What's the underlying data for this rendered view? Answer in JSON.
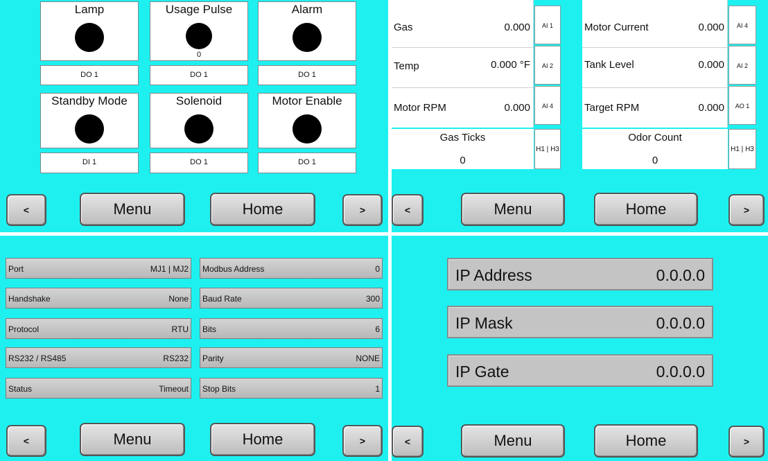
{
  "nav": {
    "prev": "<",
    "menu": "Menu",
    "home": "Home",
    "next": ">"
  },
  "panel1": {
    "indicators": [
      {
        "title": "Lamp",
        "value": "",
        "channel": "DO 1"
      },
      {
        "title": "Usage Pulse",
        "value": "0",
        "channel": "DO 1"
      },
      {
        "title": "Alarm",
        "value": "",
        "channel": "DO 1"
      },
      {
        "title": "Standby Mode",
        "value": "",
        "channel": "DI 1"
      },
      {
        "title": "Solenoid",
        "value": "",
        "channel": "DO 1"
      },
      {
        "title": "Motor Enable",
        "value": "",
        "channel": "DO 1"
      }
    ]
  },
  "panel2": {
    "left": [
      {
        "name": "Gas",
        "value": "0.000",
        "tag": "AI 1"
      },
      {
        "name": "Temp",
        "value": "0.000 °F",
        "tag": "AI 2"
      },
      {
        "name": "Motor RPM",
        "value": "0.000",
        "tag": "AI 4"
      }
    ],
    "right": [
      {
        "name": "Motor Current",
        "value": "0.000",
        "tag": "AI 4"
      },
      {
        "name": "Tank Level",
        "value": "0.000",
        "tag": "AI 2"
      },
      {
        "name": "Target RPM",
        "value": "0.000",
        "tag": "AO 1"
      }
    ],
    "ticks": [
      {
        "title": "Gas Ticks",
        "value": "0",
        "tag": "H1 | H3"
      },
      {
        "title": "Odor Count",
        "value": "0",
        "tag": "H1 | H3"
      }
    ]
  },
  "panel3": {
    "left": [
      {
        "label": "Port",
        "value": "MJ1 | MJ2"
      },
      {
        "label": "Handshake",
        "value": "None"
      },
      {
        "label": "Protocol",
        "value": "RTU"
      },
      {
        "label": "RS232 / RS485",
        "value": "RS232"
      },
      {
        "label": "Status",
        "value": "Timeout"
      }
    ],
    "right": [
      {
        "label": "Modbus Address",
        "value": "0"
      },
      {
        "label": "Baud Rate",
        "value": "300"
      },
      {
        "label": "Bits",
        "value": "6"
      },
      {
        "label": "Parity",
        "value": "NONE"
      },
      {
        "label": "Stop Bits",
        "value": "1"
      }
    ]
  },
  "panel4": {
    "rows": [
      {
        "label": "IP Address",
        "value": "0.0.0.0"
      },
      {
        "label": "IP Mask",
        "value": "0.0.0.0"
      },
      {
        "label": "IP Gate",
        "value": "0.0.0.0"
      }
    ]
  }
}
